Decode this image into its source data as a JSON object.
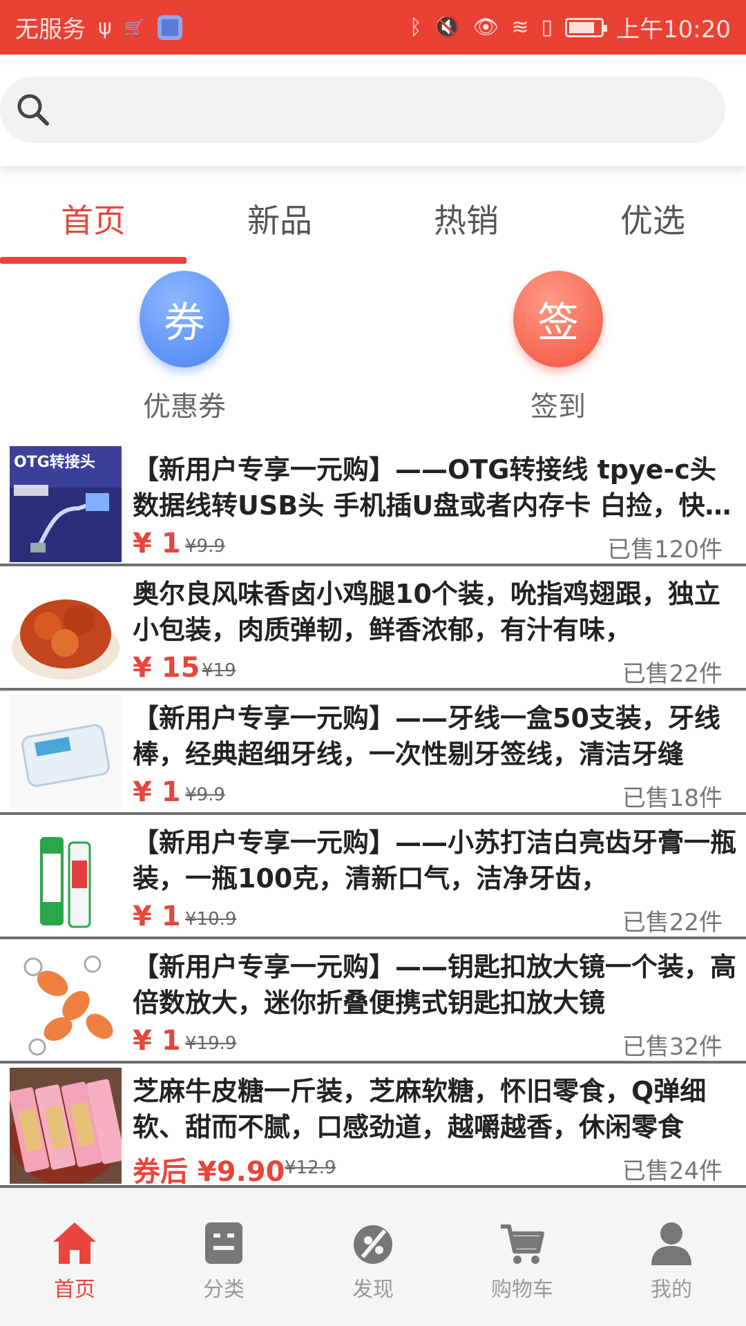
{
  "status_bar": {
    "left_text": "无服务",
    "time": "上午10:20"
  },
  "search": {
    "placeholder": ""
  },
  "tabs": [
    {
      "label": "首页",
      "active": true
    },
    {
      "label": "新品",
      "active": false
    },
    {
      "label": "热销",
      "active": false
    },
    {
      "label": "优选",
      "active": false
    }
  ],
  "quick_actions": [
    {
      "icon_char": "券",
      "label": "优惠券",
      "color": "#4a83f2"
    },
    {
      "icon_char": "签",
      "label": "签到",
      "color": "#f2523e"
    }
  ],
  "products": [
    {
      "title": "【新用户专享一元购】——OTG转接线 tpye-c头数据线转USB头 手机插U盘或者内存卡 白捡，快来抢",
      "price": "¥ 1",
      "original": "¥9.9",
      "sold": "已售120件",
      "thumb": "otg-adapter"
    },
    {
      "title": "奥尔良风味香卤小鸡腿10个装，吮指鸡翅跟，独立小包装，肉质弹韧，鲜香浓郁，有汁有味，",
      "price": "¥ 15",
      "original": "¥19",
      "sold": "已售22件",
      "thumb": "chicken-wings"
    },
    {
      "title": "【新用户专享一元购】——牙线一盒50支装，牙线棒，经典超细牙线，一次性剔牙签线，清洁牙缝",
      "price": "¥ 1",
      "original": "¥9.9",
      "sold": "已售18件",
      "thumb": "floss-box"
    },
    {
      "title": "【新用户专享一元购】——小苏打洁白亮齿牙膏一瓶装，一瓶100克，清新口气，洁净牙齿，",
      "price": "¥ 1",
      "original": "¥10.9",
      "sold": "已售22件",
      "thumb": "toothpaste"
    },
    {
      "title": "【新用户专享一元购】——钥匙扣放大镜一个装，高倍数放大，迷你折叠便携式钥匙扣放大镜",
      "price": "¥ 1",
      "original": "¥19.9",
      "sold": "已售32件",
      "thumb": "keychain-magnifier"
    },
    {
      "title": "芝麻牛皮糖一斤装，芝麻软糖，怀旧零食，Q弹细软、甜而不腻，口感劲道，越嚼越香，休闲零食",
      "price": "券后 ¥9.90",
      "original": "¥12.9",
      "sold": "已售24件",
      "thumb": "sesame-candy"
    }
  ],
  "bottom_nav": [
    {
      "label": "首页",
      "icon": "home-icon",
      "active": true
    },
    {
      "label": "分类",
      "icon": "category-icon",
      "active": false
    },
    {
      "label": "发现",
      "icon": "discover-icon",
      "active": false
    },
    {
      "label": "购物车",
      "icon": "cart-icon",
      "active": false
    },
    {
      "label": "我的",
      "icon": "profile-icon",
      "active": false
    }
  ],
  "colors": {
    "accent": "#e8453c",
    "status_bar": "#e94134",
    "inactive": "#999999"
  }
}
